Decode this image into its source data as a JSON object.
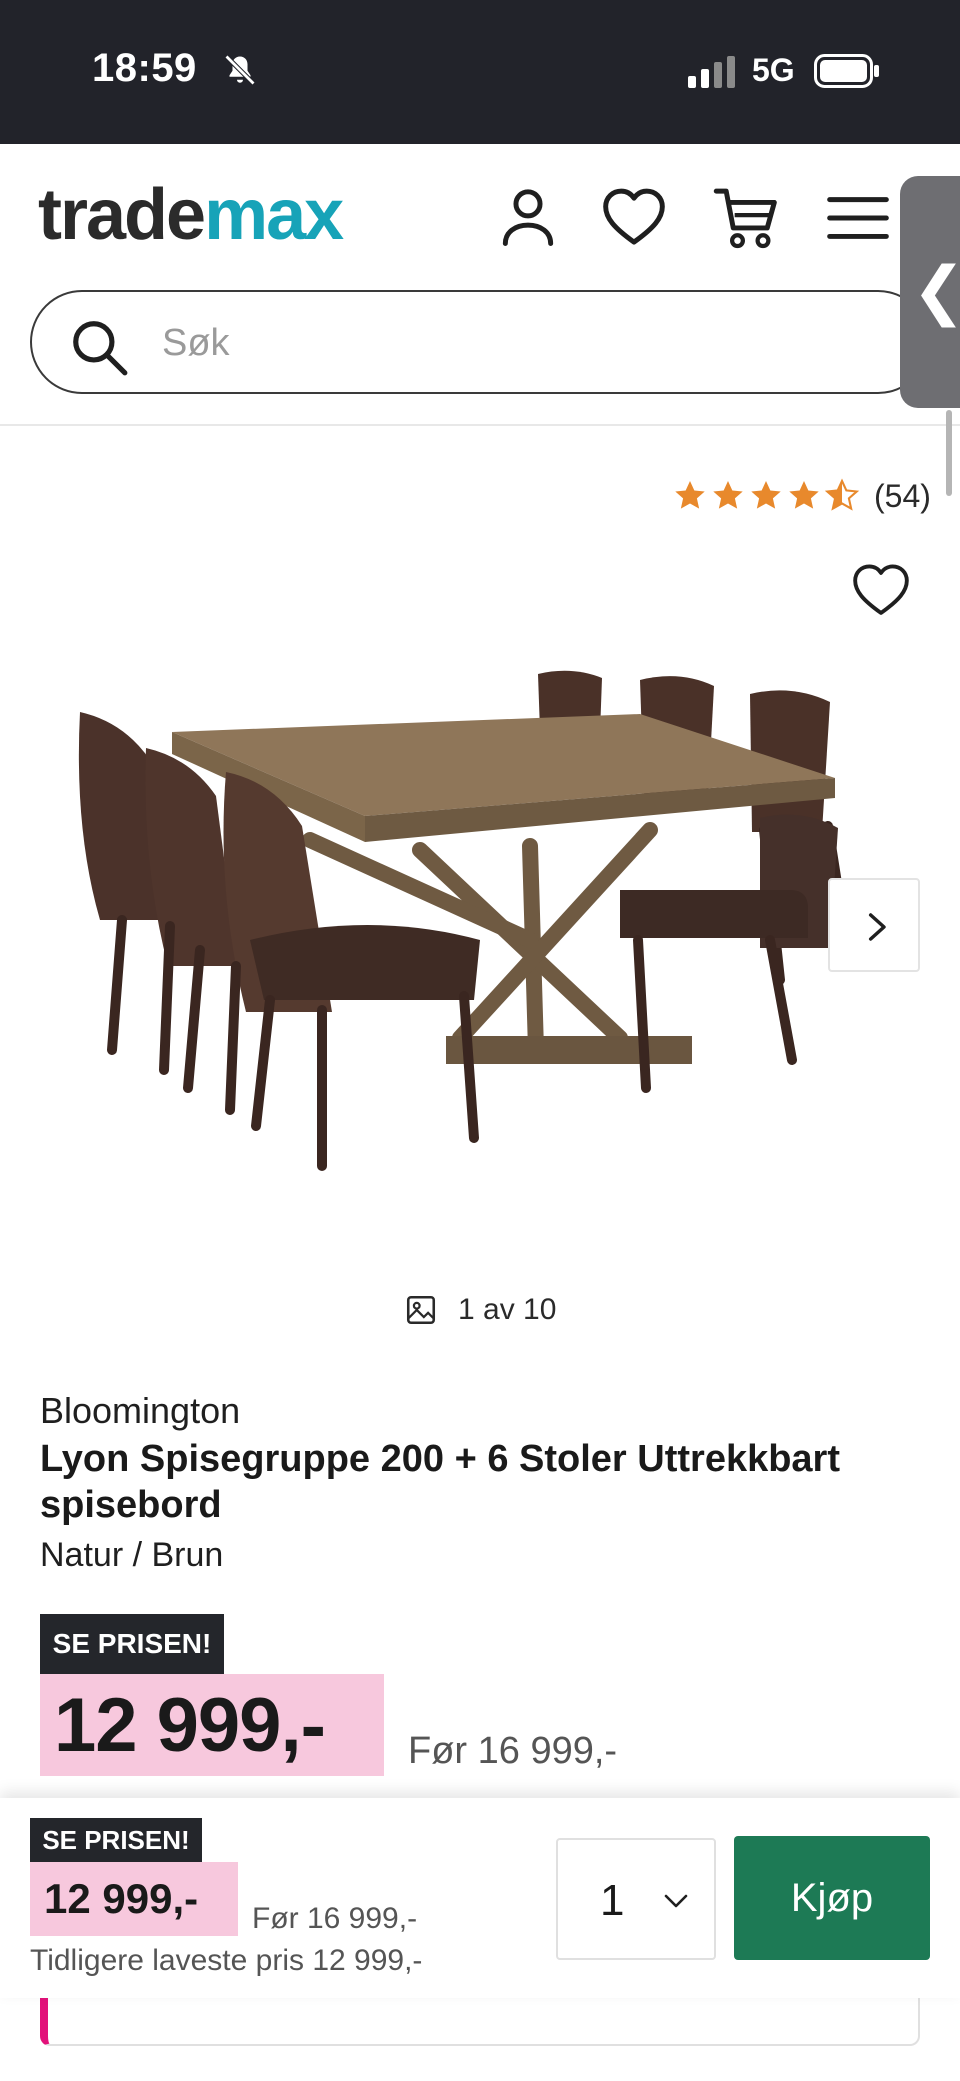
{
  "status_bar": {
    "time": "18:59",
    "network": "5G",
    "icons": [
      "bell-muted-icon",
      "signal-icon",
      "battery-icon"
    ]
  },
  "header": {
    "logo_part1": "trade",
    "logo_part2": "max",
    "logo_colors": {
      "trade": "#2b2b2b",
      "max": "#17a3b8"
    },
    "icons": [
      "account-icon",
      "heart-icon",
      "cart-icon",
      "menu-icon"
    ],
    "search_placeholder": "Søk"
  },
  "product": {
    "rating": 4.5,
    "review_count": "(54)",
    "image_counter": "1 av 10",
    "brand": "Bloomington",
    "title": "Lyon Spisegruppe 200 + 6 Stoler Uttrekkbart spisebord",
    "variant": "Natur / Brun",
    "badge": "SE PRISEN!",
    "price": "12 999,-",
    "before_price": "Før 16 999,-"
  },
  "purchase_bar": {
    "badge": "SE PRISEN!",
    "price": "12 999,-",
    "before_price": "Før 16 999,-",
    "lowest_price": "Tidligere laveste pris 12 999,-",
    "quantity": "1",
    "buy_label": "Kjøp"
  },
  "colors": {
    "accent_green": "#1d7a55",
    "price_highlight": "#f7c8dd",
    "badge_dark": "#24262b",
    "star": "#e8892c"
  }
}
